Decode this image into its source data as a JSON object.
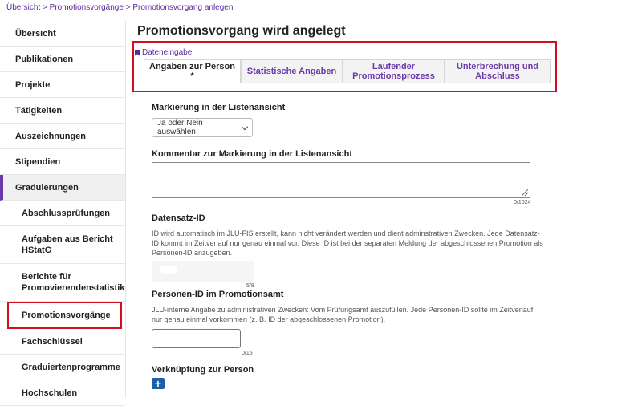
{
  "breadcrumb": {
    "items": [
      "Übersicht",
      "Promotionsvorgänge",
      "Promotionsvorgang anlegen"
    ],
    "separator": ">"
  },
  "sidebar": {
    "items": [
      {
        "label": "Übersicht"
      },
      {
        "label": "Publikationen"
      },
      {
        "label": "Projekte"
      },
      {
        "label": "Tätigkeiten"
      },
      {
        "label": "Auszeichnungen"
      },
      {
        "label": "Stipendien"
      },
      {
        "label": "Graduierungen"
      }
    ],
    "subitems": [
      {
        "label": "Abschlussprüfungen"
      },
      {
        "label": "Aufgaben aus Bericht HStatG"
      },
      {
        "label": "Berichte für Promovierendenstatistik"
      },
      {
        "label": "Promotionsvorgänge"
      },
      {
        "label": "Fachschlüssel"
      },
      {
        "label": "Graduiertenprogramme"
      },
      {
        "label": "Hochschulen"
      }
    ]
  },
  "main": {
    "title": "Promotionsvorgang wird angelegt",
    "subnav_link": "Dateneingabe",
    "tabs": [
      {
        "label": "Angaben zur Person *"
      },
      {
        "label": "Statistische Angaben"
      },
      {
        "label": "Laufender Promotionsprozess"
      },
      {
        "label": "Unterbrechung und Abschluss"
      }
    ]
  },
  "form": {
    "markierung_label": "Markierung in der Listenansicht",
    "markierung_select": "Ja oder Nein auswählen",
    "kommentar_label": "Kommentar zur Markierung in der Listenansicht",
    "kommentar_counter": "0/1024",
    "datensatz_label": "Datensatz-ID",
    "datensatz_help": "ID wird automatisch im JLU-FIS erstellt, kann nicht verändert werden und dient adminstrativen Zwecken. Jede Datensatz-ID kommt im Zeitverlauf nur genau einmal vor. Diese ID ist bei der separaten Meldung der abgeschlossenen Promotion als Personen-ID anzugeben.",
    "datensatz_counter": "5/8",
    "personen_label": "Personen-ID im Promotionsamt",
    "personen_help": "JLU-interne Angabe zu administrativen Zwecken: Vom Prüfungsamt auszufüllen. Jede Personen-ID sollte im Zeitverlauf nur genau einmal vorkommen (z. B. ID der abgeschlossenen Promotion).",
    "personen_counter": "0/15",
    "verknuepfung_label": "Verknüpfung zur Person",
    "plus_symbol": "+"
  },
  "colors": {
    "accent": "#6a3aa8",
    "highlight": "#d01020",
    "button": "#1f5fa8"
  }
}
